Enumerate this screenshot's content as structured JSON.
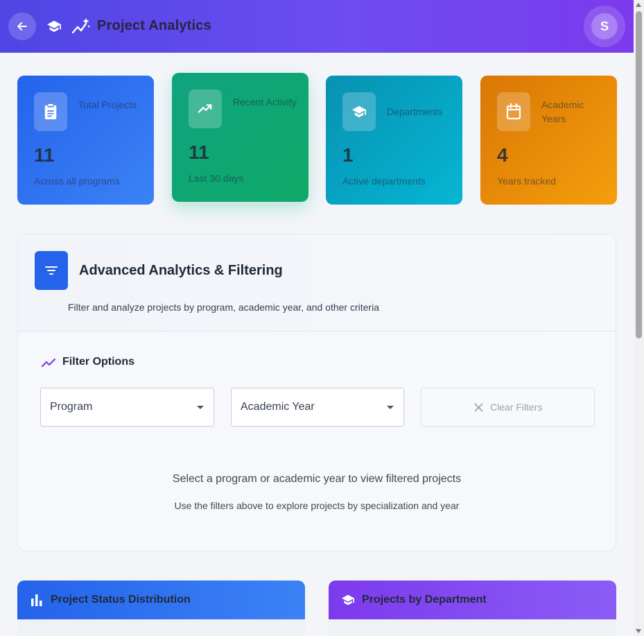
{
  "header": {
    "title": "Project Analytics",
    "avatar_initial": "S",
    "gradient_start": "#4f46e5",
    "gradient_end": "#7c3aed"
  },
  "stats": [
    {
      "label": "Total Projects",
      "value": "11",
      "sub": "Across all programs",
      "icon": "clipboard-icon",
      "color": "#2563eb"
    },
    {
      "label": "Recent Activity",
      "value": "11",
      "sub": "Last 30 days",
      "icon": "trending-up-icon",
      "color": "#10a37f"
    },
    {
      "label": "Departments",
      "value": "1",
      "sub": "Active departments",
      "icon": "graduation-cap-icon",
      "color": "#0891b2"
    },
    {
      "label": "Academic Years",
      "value": "4",
      "sub": "Years tracked",
      "icon": "calendar-icon",
      "color": "#d97706"
    }
  ],
  "analytics": {
    "title": "Advanced Analytics & Filtering",
    "description": "Filter and analyze projects by program, academic year, and other criteria",
    "filter_options_title": "Filter Options",
    "program_select": "Program",
    "year_select": "Academic Year",
    "clear_label": "Clear Filters",
    "empty_title": "Select a program or academic year to view filtered projects",
    "empty_sub": "Use the filters above to explore projects by specialization and year"
  },
  "bottom_cards": {
    "status_title": "Project Status Distribution",
    "dept_title": "Projects by Department"
  }
}
